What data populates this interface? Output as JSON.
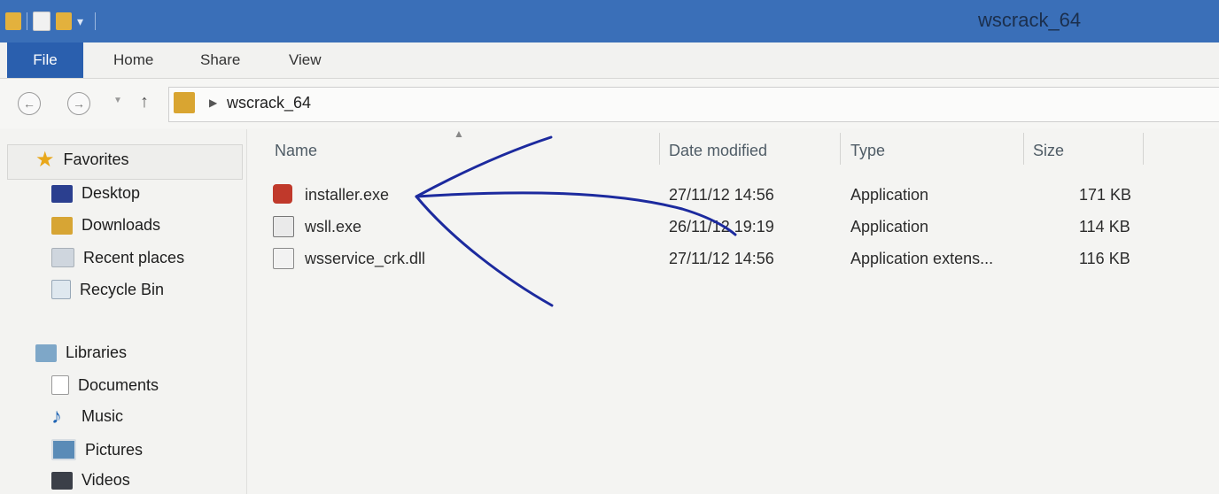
{
  "window": {
    "title": "wscrack_64"
  },
  "ribbon": {
    "tabs": [
      {
        "label": "File"
      },
      {
        "label": "Home"
      },
      {
        "label": "Share"
      },
      {
        "label": "View"
      }
    ]
  },
  "address": {
    "path": "wscrack_64"
  },
  "nav": {
    "favorites": {
      "label": "Favorites",
      "items": [
        {
          "label": "Desktop"
        },
        {
          "label": "Downloads"
        },
        {
          "label": "Recent places"
        },
        {
          "label": "Recycle Bin"
        }
      ]
    },
    "libraries": {
      "label": "Libraries",
      "items": [
        {
          "label": "Documents"
        },
        {
          "label": "Music"
        },
        {
          "label": "Pictures"
        },
        {
          "label": "Videos"
        }
      ]
    }
  },
  "columns": {
    "name": "Name",
    "date": "Date modified",
    "type": "Type",
    "size": "Size"
  },
  "files": [
    {
      "name": "installer.exe",
      "date": "27/11/12 14:56",
      "type": "Application",
      "size": "171 KB",
      "icon": "installer-icon"
    },
    {
      "name": "wsll.exe",
      "date": "26/11/12 19:19",
      "type": "Application",
      "size": "114 KB",
      "icon": "exe-window-icon"
    },
    {
      "name": "wsservice_crk.dll",
      "date": "27/11/12 14:56",
      "type": "Application extens...",
      "size": "116 KB",
      "icon": "dll-icon"
    }
  ],
  "colors": {
    "titlebar": "#3a6fb8",
    "file_tab": "#2a5fae",
    "ink": "#1c2a9e"
  }
}
